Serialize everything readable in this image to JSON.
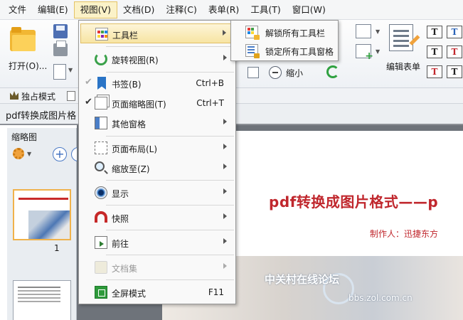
{
  "menubar": {
    "items": [
      "文件",
      "编辑(E)",
      "视图(V)",
      "文档(D)",
      "注释(C)",
      "表单(R)",
      "工具(T)",
      "窗口(W)"
    ],
    "active_index": 2
  },
  "ribbon": {
    "open_label": "打开(O)...",
    "zoom_out_label": "缩小",
    "edit_form_label": "编辑表单",
    "t_icon_glyph": "T"
  },
  "modebar": {
    "exclusive_label": "独占模式"
  },
  "tab": {
    "title": "pdf转换成图片格"
  },
  "thumbnail_panel": {
    "title": "缩略图",
    "plus_glyph": "+",
    "page_number": "1"
  },
  "document": {
    "title": "pdf转换成图片格式——p",
    "author": "制作人：迅捷东方"
  },
  "watermark": {
    "forum": "中关村在线论坛",
    "url": "bbs.zol.com.cn"
  },
  "view_menu": {
    "items": [
      {
        "label": "工具栏",
        "shortcut": "",
        "submenu": true,
        "checked": false,
        "disabled": false,
        "highlighted": true,
        "icon": "toolbar-icon"
      },
      {
        "label": "旋转视图(R)",
        "shortcut": "",
        "submenu": true,
        "checked": false,
        "disabled": false,
        "icon": "rotate-view-icon"
      },
      {
        "label": "书签(B)",
        "shortcut": "Ctrl+B",
        "submenu": false,
        "checked": true,
        "disabled": false,
        "icon": "bookmark-icon"
      },
      {
        "label": "页面缩略图(T)",
        "shortcut": "Ctrl+T",
        "submenu": false,
        "checked": true,
        "disabled": false,
        "icon": "page-thumbnails-icon"
      },
      {
        "label": "其他窗格",
        "shortcut": "",
        "submenu": true,
        "checked": false,
        "disabled": false,
        "icon": "other-panes-icon"
      },
      {
        "label": "页面布局(L)",
        "shortcut": "",
        "submenu": true,
        "checked": false,
        "disabled": false,
        "icon": "page-layout-icon"
      },
      {
        "label": "缩放至(Z)",
        "shortcut": "",
        "submenu": true,
        "checked": false,
        "disabled": false,
        "icon": "zoom-to-icon"
      },
      {
        "label": "显示",
        "shortcut": "",
        "submenu": true,
        "checked": false,
        "disabled": false,
        "icon": "display-icon"
      },
      {
        "label": "快照",
        "shortcut": "",
        "submenu": true,
        "checked": false,
        "disabled": false,
        "icon": "snapshot-icon"
      },
      {
        "label": "前往",
        "shortcut": "",
        "submenu": true,
        "checked": false,
        "disabled": false,
        "icon": "go-to-icon"
      },
      {
        "label": "文档集",
        "shortcut": "",
        "submenu": true,
        "checked": false,
        "disabled": true,
        "icon": "document-set-icon"
      },
      {
        "label": "全屏模式",
        "shortcut": "F11",
        "submenu": false,
        "checked": false,
        "disabled": false,
        "icon": "full-screen-icon"
      }
    ]
  },
  "toolbar_submenu": {
    "items": [
      {
        "label": "解锁所有工具栏",
        "icon": "unlock-toolbars-icon"
      },
      {
        "label": "锁定所有工具窗格",
        "icon": "lock-toolbars-icon"
      }
    ]
  }
}
